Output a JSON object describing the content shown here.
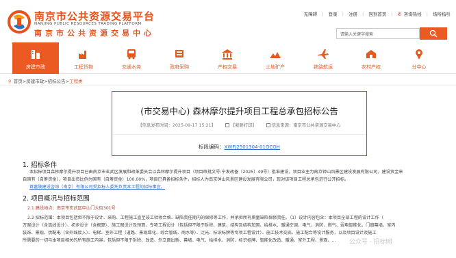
{
  "header": {
    "site_title": "南京市公共资源交易平台",
    "site_title_en": "NANJING PUBLIC RESOURCES TRADING PLATFORM",
    "site_subtitle": "南京市公共资源交易中心",
    "links": [
      "无障碍",
      "登录",
      "注册",
      "回到首页",
      "咨询热线",
      "场所指引"
    ],
    "search_placeholder": "请输入关键字搜索",
    "brand_color": "#ea5a22"
  },
  "nav": [
    {
      "label": "房建市政",
      "icon": "building-icon",
      "active": true
    },
    {
      "label": "工程货物",
      "icon": "factory-icon",
      "active": false
    },
    {
      "label": "交通水务",
      "icon": "bus-icon",
      "active": false
    },
    {
      "label": "政府采购",
      "icon": "cart-icon",
      "active": false
    },
    {
      "label": "产权交易",
      "icon": "bank-icon",
      "active": false
    },
    {
      "label": "土地矿产",
      "icon": "land-icon",
      "active": false
    },
    {
      "label": "铁路航运",
      "icon": "plane-icon",
      "active": false
    },
    {
      "label": "农村产权",
      "icon": "farm-icon",
      "active": false
    },
    {
      "label": "分中心",
      "icon": "branch-icon",
      "active": false
    }
  ],
  "breadcrumb": {
    "path": "首页>房建市政>招标公告>",
    "current": "工程类"
  },
  "notice": {
    "title": "(市交易中心) 森林摩尔提升项目工程总承包招标公告",
    "publish_time": "【信息发布时间：2025-09-17 15:21】",
    "print": "【我要打印】",
    "source": "信息来源：南京市公共资源交易中心",
    "code_label": "标段编码：",
    "code_value": "XWFJ2501304-01GCGH"
  },
  "sections": {
    "s1_title": "1. 招标条件",
    "s1_text_1": "本招标项目森林摩尔提升项目已由南京市玄武区发展和改革委员会以森林摩尔提升项目（项目审批文号:宁发改备〔2025〕49号）批准建设，项目业主为南京钟山风景区建设发展有限公司，建设资金来",
    "s1_text_2": "自国有（自筹资金），项目出资比例为国有（自筹资金）100.00%，项目已具备招标条件，招标人为南京钟山风景区建设发展有限公司，现对该项目工程总承包进行公开招标。",
    "s1_agent": "首嘉陵建设咨询（南京）有限公司受招标人委托负责本工程的招标事宜。",
    "s2_title": "2. 项目概况与招标范围",
    "s2_1": "2.1 建设地点：南京市玄武区中山门大街301号",
    "s2_2a": "2.2 招标范围：本项目包括但不限于设计、采购、工程施工直至竣工验收合格、缺陷责任期内的保修等工作，并承担所有质量缺陷保修责任。（1）设计内容包含：本项目全部工程的设计工作（",
    "s2_2b": "方案设计（含选线设计）、初步设计（含概算）、施工图设计及预算、专项工程设计（包括但不限于拆除、建筑、结构及结构加固、给排水、暖通空调、电气、消防、燃气、弱电智能化、门窗幕墙、室内",
    "s2_2c": "装饰、景观、供配电（含外线接入）、电梯、室外工程（道路、景观绿化、综合管线、雨水等）、泛光、标识标牌等专项工程设计）、施工技术交底、施工配合等设计服务，以及项目设计及施工",
    "s2_2d": "所需要的一切与本项目相关的所有施工内容，包括但不限于拆除、改造、外立面出新、幕墙、电气、给排水、消防、标识标牌、智能化改造、暖通、室外工程、景观、..."
  },
  "watermark": "公众号 · 招标网"
}
